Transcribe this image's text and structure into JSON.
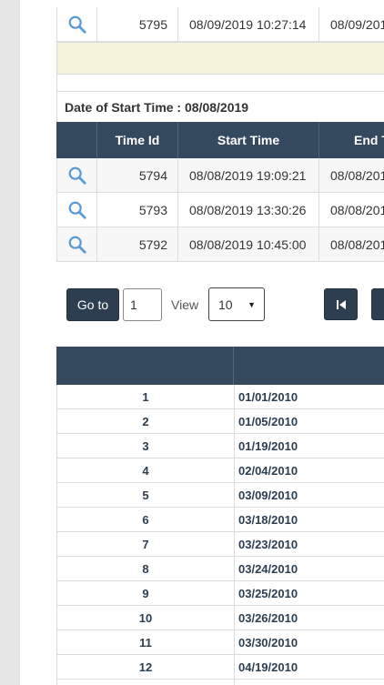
{
  "top_rows": [
    {
      "time_id": "5795",
      "start_time": "08/09/2019 10:27:14",
      "end_time": "08/09/201"
    }
  ],
  "date_group": {
    "label": "Date of Start Time : 08/08/2019",
    "headers": {
      "time_id": "Time Id",
      "start_time": "Start Time",
      "end_time": "End T"
    },
    "rows": [
      {
        "time_id": "5794",
        "start_time": "08/08/2019 19:09:21",
        "end_time": "08/08/201"
      },
      {
        "time_id": "5793",
        "start_time": "08/08/2019 13:30:26",
        "end_time": "08/08/201"
      },
      {
        "time_id": "5792",
        "start_time": "08/08/2019 10:45:00",
        "end_time": "08/08/201"
      }
    ]
  },
  "pagination": {
    "goto_label": "Go to",
    "page_value": "1",
    "view_label": "View",
    "page_size": "10",
    "first_icon": "first-page-icon"
  },
  "date_list": {
    "rows": [
      {
        "num": "1",
        "date": "01/01/2010"
      },
      {
        "num": "2",
        "date": "01/05/2010"
      },
      {
        "num": "3",
        "date": "01/19/2010"
      },
      {
        "num": "4",
        "date": "02/04/2010"
      },
      {
        "num": "5",
        "date": "03/09/2010"
      },
      {
        "num": "6",
        "date": "03/18/2010"
      },
      {
        "num": "7",
        "date": "03/23/2010"
      },
      {
        "num": "8",
        "date": "03/24/2010"
      },
      {
        "num": "9",
        "date": "03/25/2010"
      },
      {
        "num": "10",
        "date": "03/26/2010"
      },
      {
        "num": "11",
        "date": "03/30/2010"
      },
      {
        "num": "12",
        "date": "04/19/2010"
      }
    ]
  },
  "colors": {
    "header_bg": "#34495e",
    "button_bg": "#2c3e50",
    "highlight_row": "#f5f2dc",
    "icon": "#5b9bd5"
  }
}
